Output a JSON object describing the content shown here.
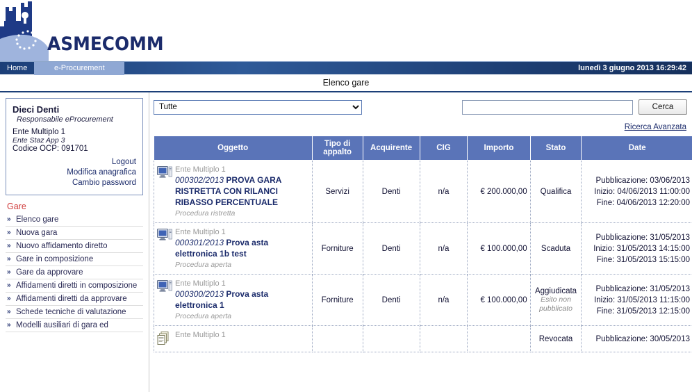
{
  "brand": {
    "wordmark": "ASMECOMM",
    "logo_icon": "castle-europe-logo"
  },
  "nav": {
    "home_label": "Home",
    "eproc_label": "e-Procurement",
    "clock": "lunedì 3 giugno 2013 16:29:42"
  },
  "page": {
    "title": "Elenco gare"
  },
  "user": {
    "name": "Dieci Denti",
    "role": "Responsabile eProcurement",
    "ente": "Ente Multiplo 1",
    "staz": "Ente Staz App 3",
    "codice": "Codice OCP: 091701",
    "links": [
      {
        "label": "Logout"
      },
      {
        "label": "Modifica anagrafica"
      },
      {
        "label": "Cambio password"
      }
    ]
  },
  "menu": {
    "heading": "Gare",
    "items": [
      {
        "label": "Elenco gare"
      },
      {
        "label": "Nuova gara"
      },
      {
        "label": "Nuovo affidamento diretto"
      },
      {
        "label": "Gare in composizione"
      },
      {
        "label": "Gare da approvare"
      },
      {
        "label": "Affidamenti diretti in composizione"
      },
      {
        "label": "Affidamenti diretti da approvare"
      },
      {
        "label": "Schede tecniche di valutazione"
      },
      {
        "label": "Modelli ausiliari di gara ed"
      }
    ]
  },
  "toolbar": {
    "filter_selected": "Tutte",
    "filter_options": [
      "Tutte"
    ],
    "search_value": "",
    "search_placeholder": "",
    "search_button": "Cerca",
    "advanced_link": "Ricerca Avanzata"
  },
  "table": {
    "headers": [
      "Oggetto",
      "Tipo di appalto",
      "Acquirente",
      "CIG",
      "Importo",
      "Stato",
      "Date"
    ],
    "rows": [
      {
        "icon": "monitor-icon",
        "ente": "Ente Multiplo 1",
        "numero": "000302/2013",
        "titolo": "PROVA GARA RISTRETTA CON RILANCI RIBASSO PERCENTUALE",
        "procedura": "Procedura ristretta",
        "tipo": "Servizi",
        "acquirente": "Denti",
        "cig": "n/a",
        "importo": "€ 200.000,00",
        "stato": "Qualifica",
        "stato_sub": "",
        "pubblicazione": "Pubblicazione: 03/06/2013",
        "inizio": "Inizio: 04/06/2013 11:00:00",
        "fine": "Fine: 04/06/2013 12:20:00"
      },
      {
        "icon": "monitor-icon",
        "ente": "Ente Multiplo 1",
        "numero": "000301/2013",
        "titolo": "Prova asta elettronica 1b test",
        "procedura": "Procedura aperta",
        "tipo": "Forniture",
        "acquirente": "Denti",
        "cig": "n/a",
        "importo": "€ 100.000,00",
        "stato": "Scaduta",
        "stato_sub": "",
        "pubblicazione": "Pubblicazione: 31/05/2013",
        "inizio": "Inizio: 31/05/2013 14:15:00",
        "fine": "Fine: 31/05/2013 15:15:00"
      },
      {
        "icon": "monitor-icon",
        "ente": "Ente Multiplo 1",
        "numero": "000300/2013",
        "titolo": "Prova asta elettronica 1",
        "procedura": "Procedura aperta",
        "tipo": "Forniture",
        "acquirente": "Denti",
        "cig": "n/a",
        "importo": "€ 100.000,00",
        "stato": "Aggiudicata",
        "stato_sub": "Esito non pubblicato",
        "pubblicazione": "Pubblicazione: 31/05/2013",
        "inizio": "Inizio: 31/05/2013 11:15:00",
        "fine": "Fine: 31/05/2013 12:15:00"
      },
      {
        "icon": "documents-icon",
        "ente": "Ente Multiplo 1",
        "numero": "",
        "titolo": "",
        "procedura": "",
        "tipo": "",
        "acquirente": "",
        "cig": "",
        "importo": "",
        "stato": "Revocata",
        "stato_sub": "",
        "pubblicazione": "Pubblicazione: 30/05/2013",
        "inizio": "",
        "fine": ""
      }
    ]
  },
  "colors": {
    "nav_blue": "#1c3f78",
    "table_header": "#5a74b8",
    "link_blue": "#1b2b6b",
    "heading_red": "#d03b3b",
    "tab_active": "#8fa8d4"
  }
}
